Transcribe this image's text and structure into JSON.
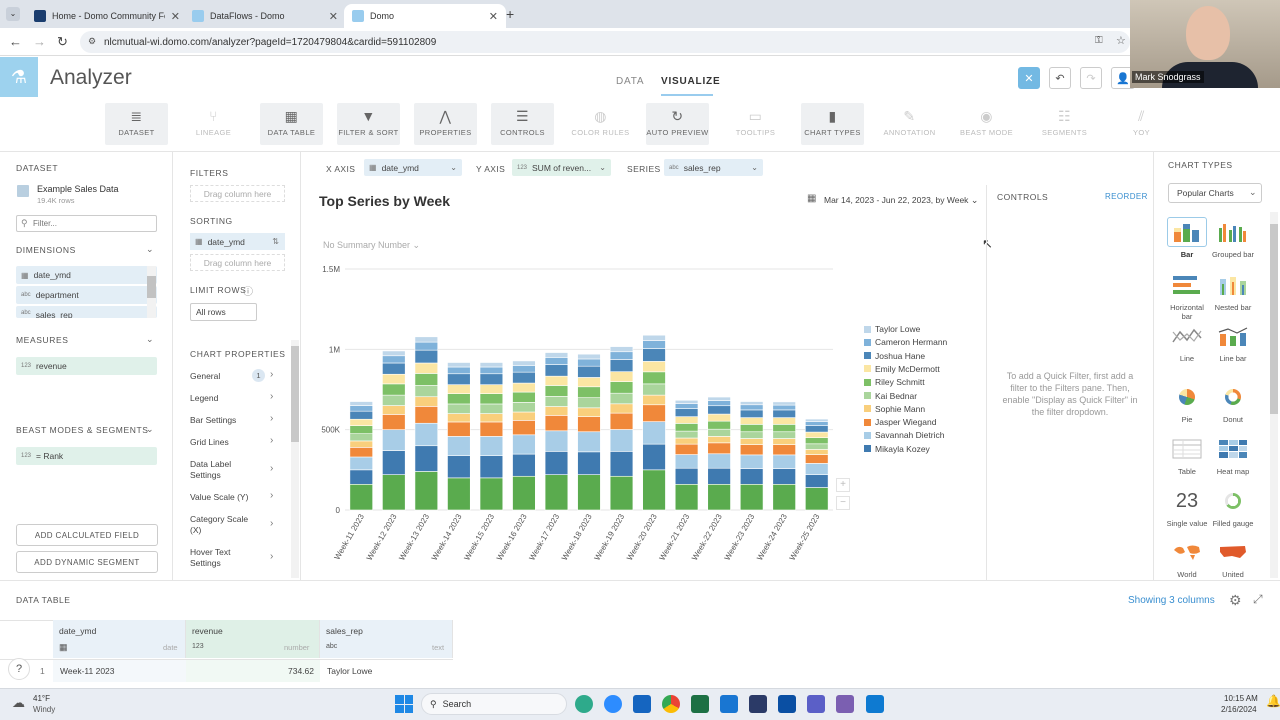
{
  "browser": {
    "tabs": [
      {
        "title": "Home - Domo Community Forum",
        "favicon_color": "#1a3d6e"
      },
      {
        "title": "DataFlows - Domo",
        "favicon_color": "#99ccee"
      },
      {
        "title": "Domo",
        "favicon_color": "#99ccee"
      }
    ],
    "url": "nlcmutual-wi.domo.com/analyzer?pageId=1720479804&cardid=591102809"
  },
  "app": {
    "title": "Analyzer",
    "view_tabs": [
      "DATA",
      "VISUALIZE"
    ],
    "active_view": "VISUALIZE"
  },
  "video": {
    "name": "Mark Snodgrass"
  },
  "toolbar": {
    "items": [
      {
        "label": "DATASET",
        "icon": "database-icon",
        "state": "on"
      },
      {
        "label": "LINEAGE",
        "icon": "lineage-icon",
        "state": "dis"
      },
      {
        "label": "DATA TABLE",
        "icon": "table-icon",
        "state": "on"
      },
      {
        "label": "FILTER & SORT",
        "icon": "filter-icon",
        "state": "on"
      },
      {
        "label": "PROPERTIES",
        "icon": "properties-icon",
        "state": "on"
      },
      {
        "label": "CONTROLS",
        "icon": "controls-icon",
        "state": "on"
      },
      {
        "label": "COLOR RULES",
        "icon": "palette-icon",
        "state": "dis"
      },
      {
        "label": "AUTO PREVIEW",
        "icon": "refresh-icon",
        "state": "on"
      },
      {
        "label": "TOOLTIPS",
        "icon": "tooltip-icon",
        "state": "dis"
      },
      {
        "label": "CHART TYPES",
        "icon": "bar-chart-icon",
        "state": "on"
      },
      {
        "label": "ANNOTATION",
        "icon": "pen-icon",
        "state": "dis"
      },
      {
        "label": "BEAST MODE",
        "icon": "beast-icon",
        "state": "dis"
      },
      {
        "label": "SEGMENTS",
        "icon": "segments-icon",
        "state": "dis"
      },
      {
        "label": "YOY",
        "icon": "yoy-icon",
        "state": "dis"
      }
    ]
  },
  "dataset": {
    "section": "DATASET",
    "name": "Example Sales Data",
    "rows": "19.4K rows",
    "filter_placeholder": "Filter...",
    "dimensions_label": "DIMENSIONS",
    "dimensions": [
      {
        "type": "date",
        "name": "date_ymd"
      },
      {
        "type": "abc",
        "name": "department"
      },
      {
        "type": "abc",
        "name": "sales_rep"
      }
    ],
    "measures_label": "MEASURES",
    "measures": [
      {
        "type": "123",
        "name": "revenue"
      }
    ],
    "beast_label": "BEAST MODES & SEGMENTS",
    "beast_modes": [
      {
        "type": "123",
        "name": "= Rank"
      }
    ],
    "add_calc": "ADD CALCULATED FIELD",
    "add_segment": "ADD DYNAMIC SEGMENT"
  },
  "filters": {
    "filters_label": "FILTERS",
    "drag_text": "Drag column here",
    "sorting_label": "SORTING",
    "sort_field": "date_ymd",
    "limit_label": "LIMIT ROWS",
    "limit_value": "All rows",
    "chart_props_label": "CHART PROPERTIES",
    "props": [
      {
        "label": "General",
        "badge": "1"
      },
      {
        "label": "Legend"
      },
      {
        "label": "Bar Settings"
      },
      {
        "label": "Grid Lines"
      },
      {
        "label": "Data Label Settings"
      },
      {
        "label": "Value Scale (Y)"
      },
      {
        "label": "Category Scale (X)"
      },
      {
        "label": "Hover Text Settings"
      }
    ]
  },
  "axes": {
    "x_label": "X AXIS",
    "x_value": "date_ymd",
    "y_label": "Y AXIS",
    "y_value": "SUM of reven...",
    "series_label": "SERIES",
    "series_value": "sales_rep"
  },
  "card": {
    "title": "Top Series by Week",
    "date_range": "Mar 14, 2023 - Jun 22, 2023, by Week",
    "summary": "No Summary Number"
  },
  "chart_data": {
    "type": "bar",
    "stacked": true,
    "grid": true,
    "legend_position": "right",
    "ylim": [
      0,
      1500000
    ],
    "y_ticks": [
      {
        "value": 0,
        "label": "0"
      },
      {
        "value": 500000,
        "label": "500K"
      },
      {
        "value": 1000000,
        "label": "1M"
      },
      {
        "value": 1500000,
        "label": "1.5M"
      }
    ],
    "categories": [
      "Week-11 2023",
      "Week-12 2023",
      "Week-13 2023",
      "Week-14 2023",
      "Week-15 2023",
      "Week-16 2023",
      "Week-17 2023",
      "Week-18 2023",
      "Week-19 2023",
      "Week-20 2023",
      "Week-21 2023",
      "Week-22 2023",
      "Week-23 2023",
      "Week-24 2023",
      "Week-25 2023"
    ],
    "series": [
      {
        "name": "Taylor Lowe",
        "color": "#bfd7ea",
        "values": [
          25000,
          30000,
          33000,
          28000,
          28000,
          28000,
          30000,
          30000,
          32000,
          33000,
          20000,
          22000,
          20000,
          20000,
          16000
        ]
      },
      {
        "name": "Cameron Hermann",
        "color": "#7fb2da",
        "values": [
          35000,
          45000,
          50000,
          42000,
          42000,
          42000,
          45000,
          45000,
          48000,
          50000,
          32000,
          32000,
          32000,
          30000,
          25000
        ]
      },
      {
        "name": "Joshua Hane",
        "color": "#4b86b8",
        "values": [
          50000,
          70000,
          80000,
          68000,
          68000,
          68000,
          72000,
          70000,
          76000,
          80000,
          50000,
          52000,
          48000,
          48000,
          40000
        ]
      },
      {
        "name": "Emily McDermott",
        "color": "#fbe6a3",
        "values": [
          40000,
          60000,
          65000,
          56000,
          56000,
          56000,
          58000,
          58000,
          62000,
          65000,
          42000,
          44000,
          42000,
          42000,
          35000
        ]
      },
      {
        "name": "Riley Schmitt",
        "color": "#7dc066",
        "values": [
          50000,
          70000,
          75000,
          64000,
          64000,
          64000,
          68000,
          68000,
          72000,
          75000,
          48000,
          50000,
          46000,
          46000,
          38000
        ]
      },
      {
        "name": "Kai Bednar",
        "color": "#aad59c",
        "values": [
          45000,
          65000,
          70000,
          60000,
          60000,
          60000,
          63000,
          63000,
          66000,
          70000,
          43000,
          45000,
          42000,
          42000,
          35000
        ]
      },
      {
        "name": "Sophie Mann",
        "color": "#f9cf7c",
        "values": [
          40000,
          55000,
          60000,
          52000,
          52000,
          52000,
          55000,
          55000,
          58000,
          60000,
          38000,
          40000,
          38000,
          38000,
          32000
        ]
      },
      {
        "name": "Jasper Wiegand",
        "color": "#f0883a",
        "values": [
          60000,
          95000,
          105000,
          90000,
          90000,
          90000,
          96000,
          94000,
          102000,
          105000,
          65000,
          68000,
          64000,
          64000,
          55000
        ]
      },
      {
        "name": "Savannah Dietrich",
        "color": "#a8cde7",
        "values": [
          80000,
          130000,
          140000,
          120000,
          120000,
          120000,
          128000,
          125000,
          136000,
          140000,
          85000,
          90000,
          85000,
          85000,
          70000
        ]
      },
      {
        "name": "Mikayla Kozey",
        "color": "#3f7ab0",
        "values": [
          90000,
          150000,
          160000,
          138000,
          138000,
          138000,
          145000,
          142000,
          155000,
          160000,
          100000,
          100000,
          98000,
          98000,
          80000
        ]
      },
      {
        "name": "",
        "color": "#5aab4e",
        "values": [
          160000,
          220000,
          240000,
          200000,
          200000,
          210000,
          220000,
          220000,
          210000,
          250000,
          160000,
          160000,
          160000,
          160000,
          140000
        ]
      }
    ]
  },
  "controls": {
    "title": "CONTROLS",
    "reorder": "REORDER",
    "message": "To add a Quick Filter, first add a filter to the Filters pane. Then, enable \"Display as Quick Filter\" in the filter dropdown."
  },
  "chart_types": {
    "title": "CHART TYPES",
    "select": "Popular Charts",
    "items": [
      {
        "label": "Bar",
        "icon": "stacked-bar-icon",
        "selected": true
      },
      {
        "label": "Grouped bar",
        "icon": "grouped-bar-icon"
      },
      {
        "label": "Horizontal bar",
        "icon": "horizontal-bar-icon"
      },
      {
        "label": "Nested bar",
        "icon": "nested-bar-icon"
      },
      {
        "label": "Line",
        "icon": "line-chart-icon"
      },
      {
        "label": "Line bar",
        "icon": "line-bar-icon"
      },
      {
        "label": "Pie",
        "icon": "pie-chart-icon"
      },
      {
        "label": "Donut",
        "icon": "donut-chart-icon"
      },
      {
        "label": "Table",
        "icon": "table-chart-icon"
      },
      {
        "label": "Heat map",
        "icon": "heat-map-icon"
      },
      {
        "label": "Single value",
        "icon": "single-value-icon",
        "value": "23"
      },
      {
        "label": "Filled gauge",
        "icon": "gauge-icon"
      },
      {
        "label": "World",
        "icon": "world-map-icon"
      },
      {
        "label": "United",
        "icon": "us-map-icon"
      }
    ]
  },
  "data_table": {
    "title": "DATA TABLE",
    "showing": "Showing 3 columns",
    "columns": [
      {
        "name": "date_ymd",
        "type": "date"
      },
      {
        "name": "revenue",
        "type": "number",
        "type_icon": "123"
      },
      {
        "name": "sales_rep",
        "type": "text",
        "type_icon": "abc"
      }
    ],
    "rows": [
      {
        "index": "1",
        "date_ymd": "Week-11 2023",
        "revenue": "734.62",
        "sales_rep": "Taylor Lowe"
      }
    ]
  },
  "taskbar": {
    "weather_temp": "41°F",
    "weather_desc": "Windy",
    "search": "Search",
    "time": "10:15 AM",
    "date": "2/16/2024"
  }
}
